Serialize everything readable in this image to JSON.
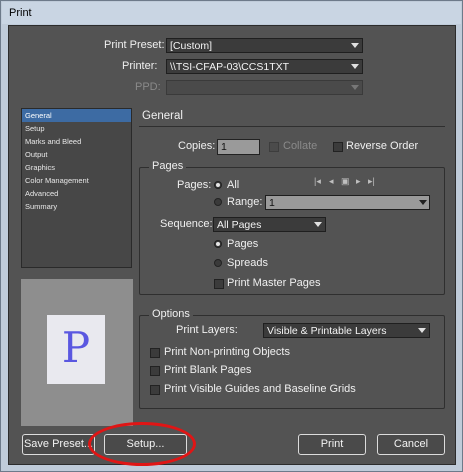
{
  "window": {
    "title": "Print"
  },
  "print_preset": {
    "label": "Print Preset:",
    "value": "[Custom]"
  },
  "printer": {
    "label": "Printer:",
    "value": "\\\\TSI-CFAP-03\\CCS1TXT"
  },
  "ppd": {
    "label": "PPD:",
    "value": ""
  },
  "sidebar": {
    "items": [
      {
        "label": "General",
        "selected": true
      },
      {
        "label": "Setup"
      },
      {
        "label": "Marks and Bleed"
      },
      {
        "label": "Output"
      },
      {
        "label": "Graphics"
      },
      {
        "label": "Color Management"
      },
      {
        "label": "Advanced"
      },
      {
        "label": "Summary"
      }
    ]
  },
  "preview": {
    "glyph": "P"
  },
  "general": {
    "heading": "General",
    "copies_label": "Copies:",
    "copies_value": "1",
    "collate_label": "Collate",
    "reverse_order_label": "Reverse Order"
  },
  "pages": {
    "title": "Pages",
    "pages_label": "Pages:",
    "all_label": "All",
    "range_label": "Range:",
    "range_value": "1",
    "sequence_label": "Sequence:",
    "sequence_value": "All Pages",
    "pages_option": "Pages",
    "spreads_option": "Spreads",
    "master_pages_label": "Print Master Pages",
    "nav_icons": [
      "first-page-icon",
      "prev-page-icon",
      "page-icon",
      "next-page-icon",
      "last-page-icon"
    ]
  },
  "options": {
    "title": "Options",
    "print_layers_label": "Print Layers:",
    "print_layers_value": "Visible & Printable Layers",
    "non_printing_label": "Print Non-printing Objects",
    "blank_pages_label": "Print Blank Pages",
    "guides_label": "Print Visible Guides and Baseline Grids"
  },
  "buttons": {
    "save_preset": "Save Preset...",
    "setup": "Setup...",
    "print": "Print",
    "cancel": "Cancel"
  },
  "colors": {
    "panel": "#535353",
    "selection": "#3d6ba3",
    "preview_glyph": "#5a57e0",
    "annotation": "#e01515"
  }
}
